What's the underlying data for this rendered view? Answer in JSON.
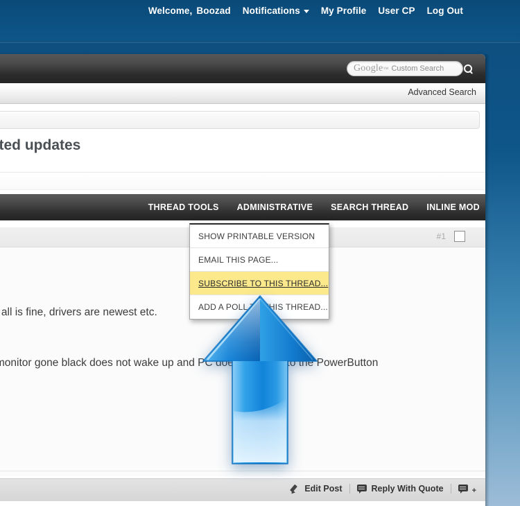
{
  "topbar": {
    "welcome_label": "Welcome,",
    "username": "Boozad",
    "notifications_label": "Notifications",
    "caret_icon": "chevron-down-icon",
    "my_profile_label": "My Profile",
    "user_cp_label": "User CP",
    "log_out_label": "Log Out"
  },
  "search": {
    "google_logo_text": "Google",
    "google_logo_sup": "™",
    "placeholder_text": "Custom Search",
    "search_icon": "search-icon",
    "advanced_search_label": "Advanced Search"
  },
  "thread": {
    "title": "nated updates"
  },
  "toolbar": {
    "items": [
      {
        "label": "THREAD TOOLS"
      },
      {
        "label": "ADMINISTRATIVE"
      },
      {
        "label": "SEARCH THREAD"
      },
      {
        "label": "INLINE MOD"
      }
    ]
  },
  "dropdown": {
    "items": [
      {
        "label": "SHOW PRINTABLE VERSION",
        "highlighted": false
      },
      {
        "label": "EMAIL THIS PAGE...",
        "highlighted": false
      },
      {
        "label": "SUBSCRIBE TO THIS THREAD...",
        "highlighted": true
      },
      {
        "label": "ADD A POLL TO THIS THREAD...",
        "highlighted": false
      }
    ]
  },
  "post": {
    "number": "#1",
    "checkbox_name": "post-select-checkbox",
    "paragraph_1": "g keyboard... all is fine, drivers are newest etc.",
    "paragraph_2": "unning. The monitor gone black does not wake up and PC does not react to the PowerButton"
  },
  "footer": {
    "edit_post_label": "Edit Post",
    "edit_post_icon": "pencil-icon",
    "reply_with_quote_label": "Reply With Quote",
    "reply_with_quote_icon": "speech-bubble-icon",
    "multi_quote_icon": "speech-bubble-plus-icon",
    "multi_quote_plus": "+"
  },
  "annotation": {
    "arrow_icon": "up-arrow-annotation",
    "arrow_color": "#1e8fe0"
  },
  "colors": {
    "page_background_top": "#0d4c7c",
    "page_background_bottom": "#9dbdd8",
    "highlight_yellow": "#fbe98c",
    "toolbar_dark": "#2e2e2e"
  }
}
